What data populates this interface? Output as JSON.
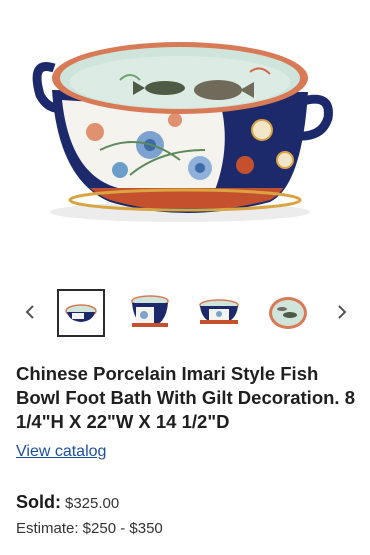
{
  "product": {
    "title": "Chinese Porcelain Imari Style Fish Bowl Foot Bath With Gilt Decoration. 8 1/4\"H X 22\"W X 14 1/2\"D",
    "view_catalog_label": "View catalog",
    "sold_label": "Sold:",
    "sold_price": "$325.00",
    "estimate": "Estimate: $250 - $350"
  },
  "gallery": {
    "thumbnail_count": 4,
    "selected_index": 0
  },
  "colors": {
    "link": "#1d4fa0",
    "cobalt": "#1c2a6b",
    "rust": "#c4502e",
    "gilt": "#d9a441",
    "celadon": "#cfe5dc"
  },
  "icons": {
    "prev": "chevron-left-icon",
    "next": "chevron-right-icon"
  }
}
